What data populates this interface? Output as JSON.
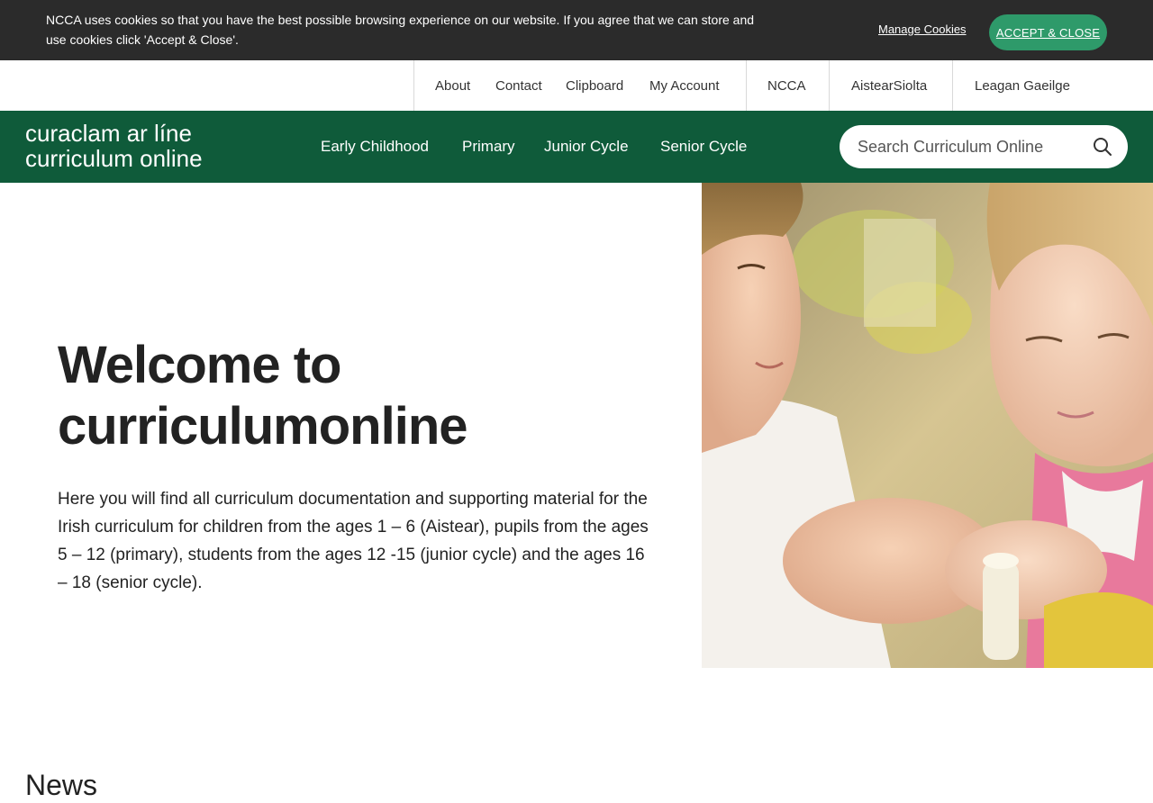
{
  "cookie_bar": {
    "message": "NCCA uses cookies so that you have the best possible browsing experience on our website. If you agree that we can store and use cookies click 'Accept & Close'.",
    "manage_label": "Manage Cookies",
    "accept_label": "ACCEPT & CLOSE"
  },
  "utility_nav": {
    "items": [
      "About",
      "Contact",
      "Clipboard",
      "My Account",
      "NCCA",
      "AistearSiolta",
      "Leagan Gaeilge"
    ]
  },
  "main_nav": {
    "logo_line1": "curaclam ar líne",
    "logo_line2": "curriculum online",
    "links": [
      "Early Childhood",
      "Primary",
      "Junior Cycle",
      "Senior Cycle"
    ],
    "search_placeholder": "Search Curriculum Online"
  },
  "hero": {
    "title_line1": "Welcome to",
    "title_line2": "curriculumonline",
    "body": "Here you will find all curriculum documentation and supporting material for the Irish curriculum for children from the ages 1 – 6 (Aistear), pupils from the ages 5 – 12 (primary), students from the ages 12 -15 (junior cycle) and the ages 16 – 18 (senior cycle)."
  },
  "news": {
    "heading": "News"
  },
  "colors": {
    "brand_green": "#0f5b3a",
    "accept_green": "#2e9a6a",
    "cookie_bg": "#2b2b2b"
  }
}
